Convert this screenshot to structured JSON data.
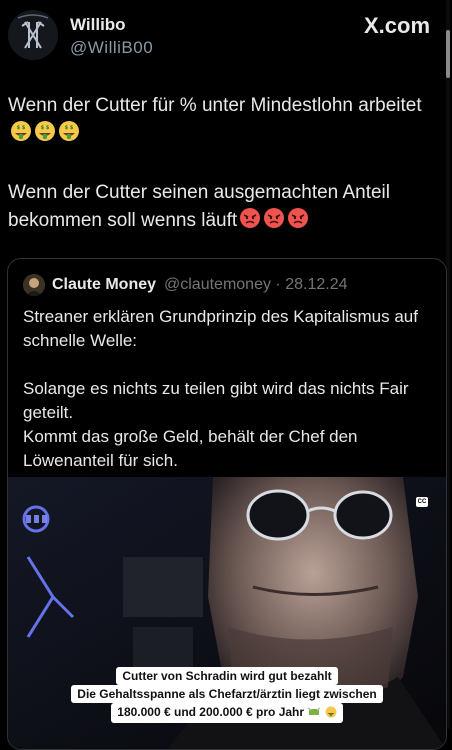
{
  "author": {
    "name": "Willibo",
    "handle": "@WilliB00"
  },
  "brand": "X.com",
  "post": {
    "paragraph1": "Wenn der Cutter für % unter Mindestlohn arbeitet",
    "paragraph1_emojis": [
      "money-mouth-face",
      "money-mouth-face",
      "money-mouth-face"
    ],
    "paragraph2": "Wenn der Cutter seinen ausgemachten Anteil bekommen soll wenns läuft",
    "paragraph2_emojis": [
      "angry-face",
      "angry-face",
      "angry-face"
    ]
  },
  "quoted": {
    "name": "Claute Money",
    "handle": "@clautemoney",
    "separator": "·",
    "date": "28.12.24",
    "text1": "Streaner erklären Grundprinzip des Kapitalismus auf schnelle  Welle:",
    "text2": "Solange es nichts zu teilen gibt wird das nichts Fair geteilt.",
    "text3": "Kommt das große Geld, behält der Chef den Löwenanteil für sich.",
    "video": {
      "cc_label": "CC",
      "caption_line1": "Cutter von Schradin wird gut bezahlt",
      "caption_line2": "Die Gehaltsspanne als Chefarzt/ärztin liegt zwischen",
      "caption_line3": "180.000 € und 200.000 € pro Jahr",
      "caption_emojis": [
        "money-with-wings",
        "money-mouth-face"
      ]
    }
  },
  "colors": {
    "background": "#000000",
    "text": "#e7e9ea",
    "secondary": "#71767b",
    "border": "#2f3336"
  }
}
